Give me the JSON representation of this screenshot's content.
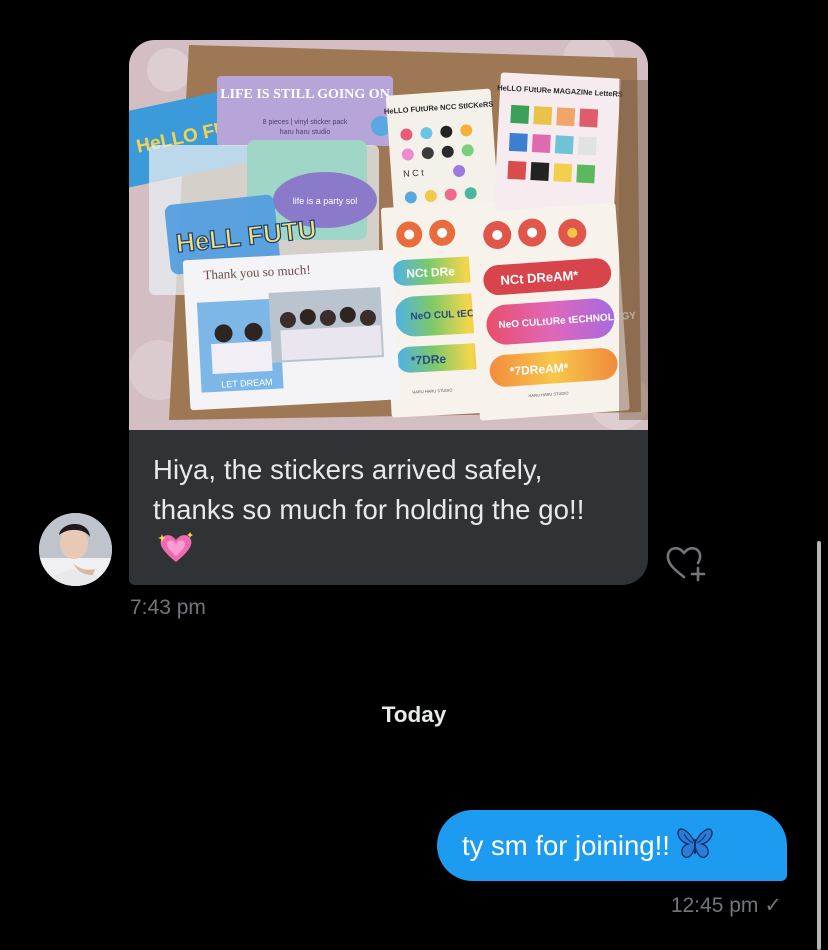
{
  "conversation": {
    "incoming_message": {
      "text": "Hiya, the stickers arrived safely, thanks so much for holding the go!!",
      "emoji": "sparkling-heart-emoji",
      "timestamp": "7:43 pm",
      "photo": {
        "sticker_labels": {
          "hello_fu": "HeLLO FU",
          "life_title": "LIFE IS STILL GOING ON",
          "life_sub": "8 pieces | vinyl sticker pack",
          "life_studio": "haru haru studio",
          "hell_futu": "HeLL FUTU",
          "life_party": "life is a party sol",
          "hello_future_ncc": "HeLLO FUtURe NCC StICKeRS",
          "hello_future_mag": "HeLLO FUtURe MAGAZINe LetteRS",
          "thank_you": "Thank you so much!",
          "let_dream": "LET DREAM",
          "nct_dream_a": "NCt DRe",
          "nct_dream_b": "NCt DReAM*",
          "neo_culture_a": "NeO CUL tECHNO",
          "neo_culture_b": "NeO CULtURe tECHNOLOGY",
          "seven_dream_a": "*7DRe",
          "seven_dream_b": "*7DReAM*",
          "studio_a": "HARU HARU STUDIO",
          "studio_b": "HARU HARU STUDIO",
          "nct_letters": "N C t"
        }
      }
    },
    "day_separator": "Today",
    "outgoing_message": {
      "text": "ty sm for joining!!",
      "emoji": "blue-butterfly-emoji",
      "timestamp": "12:45 pm",
      "status_icon": "sent-check-icon"
    },
    "react_icon": "add-reaction-heart-icon",
    "colors": {
      "background": "#000000",
      "incoming_bubble": "#2f3336",
      "outgoing_bubble": "#1d9bf0",
      "timestamp": "#71767b"
    }
  }
}
